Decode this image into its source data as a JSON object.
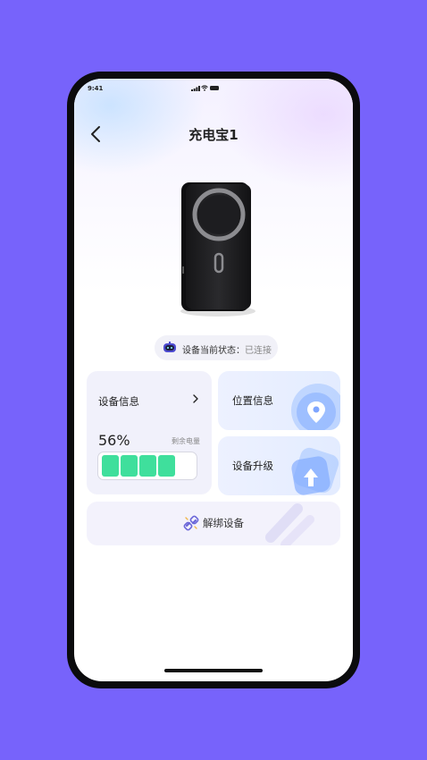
{
  "status_bar": {
    "time": "9:41"
  },
  "header": {
    "title": "充电宝1"
  },
  "device_status": {
    "label": "设备当前状态：",
    "value": "已连接"
  },
  "device_info": {
    "title": "设备信息",
    "battery_percent_text": "56%",
    "battery_fraction": 0.56,
    "remaining_label": "剩余电量"
  },
  "location_card": {
    "title": "位置信息"
  },
  "upgrade_card": {
    "title": "设备升级"
  },
  "unbind": {
    "label": "解绑设备"
  },
  "colors": {
    "background": "#7763fb",
    "battery_fill": "#3fdf9c",
    "accent_blue": "#4b8dff"
  },
  "icons": [
    "back-icon",
    "robot-icon",
    "chevron-right-icon",
    "location-pin-icon",
    "upload-arrow-icon",
    "unlink-icon"
  ]
}
